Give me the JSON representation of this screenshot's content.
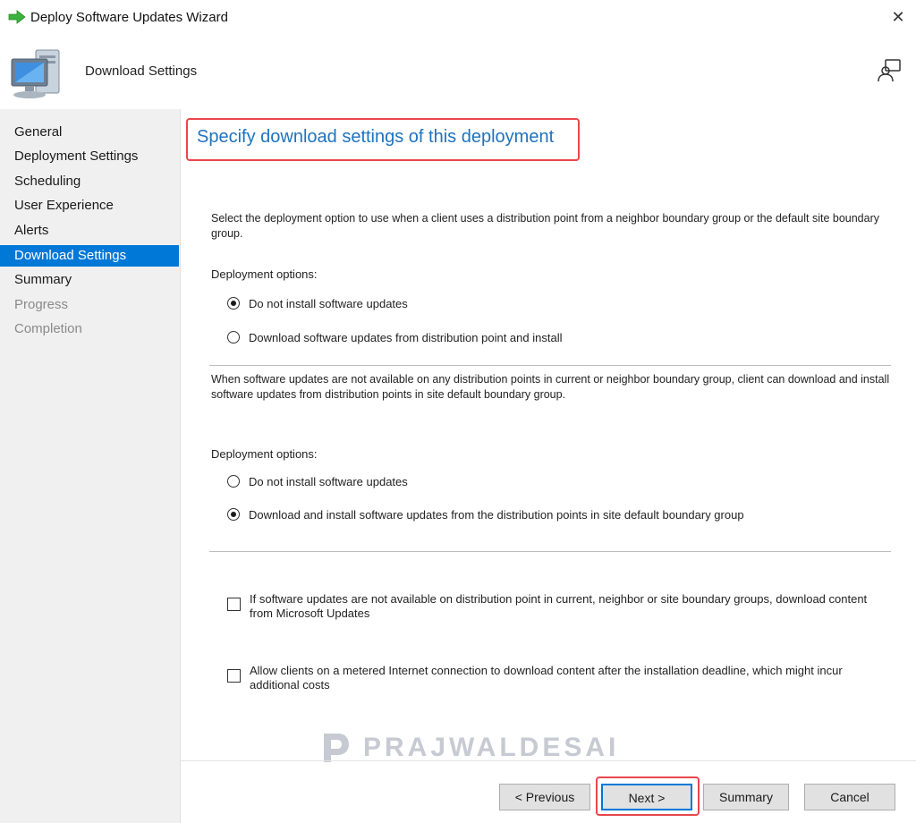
{
  "window": {
    "title": "Deploy Software Updates Wizard",
    "close_glyph": "✕"
  },
  "header": {
    "page_heading": "Download Settings"
  },
  "sidebar": {
    "items": [
      {
        "label": "General",
        "state": "normal"
      },
      {
        "label": "Deployment Settings",
        "state": "normal"
      },
      {
        "label": "Scheduling",
        "state": "normal"
      },
      {
        "label": "User Experience",
        "state": "normal"
      },
      {
        "label": "Alerts",
        "state": "normal"
      },
      {
        "label": "Download Settings",
        "state": "active"
      },
      {
        "label": "Summary",
        "state": "normal"
      },
      {
        "label": "Progress",
        "state": "disabled"
      },
      {
        "label": "Completion",
        "state": "disabled"
      }
    ]
  },
  "main": {
    "heading": "Specify download settings of this deployment",
    "section1": {
      "description": "Select the deployment option to use when a client uses a distribution point from a neighbor boundary group or the default site boundary group.",
      "label": "Deployment options:",
      "options": [
        {
          "label": "Do not install software updates",
          "checked": true
        },
        {
          "label": "Download software updates from distribution point and install",
          "checked": false
        }
      ]
    },
    "section2": {
      "description": "When software updates are not available on any distribution points in current or neighbor boundary group, client can download and install software updates from distribution points in site default boundary group.",
      "label": "Deployment options:",
      "options": [
        {
          "label": "Do not install software updates",
          "checked": false
        },
        {
          "label": "Download and install software updates from the distribution points in site default boundary group",
          "checked": true
        }
      ]
    },
    "checkboxes": [
      {
        "label": "If software updates are not available on distribution point in current, neighbor or site boundary groups, download content from Microsoft Updates",
        "checked": false
      },
      {
        "label": "Allow clients on a metered Internet connection to download content after the installation deadline, which might incur additional costs",
        "checked": false
      }
    ]
  },
  "watermark": {
    "text": "PRAJWALDESAI"
  },
  "footer": {
    "previous_label": "< Previous",
    "next_label": "Next >",
    "summary_label": "Summary",
    "cancel_label": "Cancel"
  },
  "colors": {
    "accent": "#0078d7",
    "heading_text": "#1e73be",
    "highlight_red": "#e8474c",
    "sidebar_bg": "#f0f0f0"
  },
  "icons": {
    "app": "green-arrow-icon",
    "header": "computer-icon",
    "feedback": "feedback-icon",
    "watermark": "prajwaldesai-logo"
  }
}
